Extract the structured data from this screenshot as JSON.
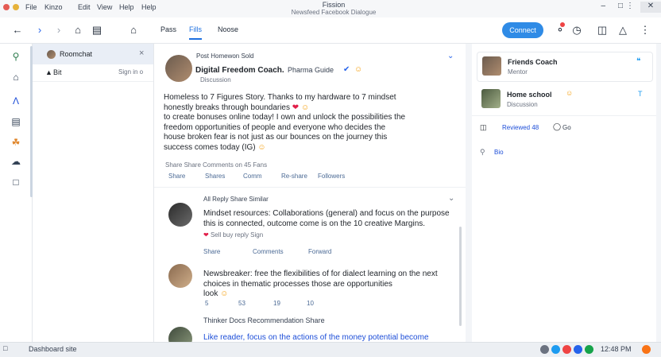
{
  "titlebar": {
    "menus": [
      "File",
      "Kinzo",
      "Edit",
      "View",
      "Help",
      "Help"
    ],
    "title": "Fission",
    "subtitle": "Newsfeed Facebook Dialogue"
  },
  "toolbar": {
    "tabs": [
      "Pass",
      "Fills",
      "Noose"
    ],
    "cta_label": "Connect"
  },
  "sidebar": {
    "chat_title": "Roomchat",
    "row_label": "Bit",
    "row_meta": "Sign in o"
  },
  "feed": {
    "post": {
      "header": "Post   Homewon   Sold",
      "author": "Digital Freedom Coach.",
      "author_extra": "Pharma Guide",
      "time": "Discussion",
      "lines": [
        "Homeless to 7 Figures Story. Thanks to my hardware to 7 mindset",
        "honestly breaks through boundaries",
        "to create bonuses online today! I own and unlock the possibilities the",
        "freedom opportunities of people and everyone who decides the",
        "house broken fear is not just as our bounces on the journey this",
        "success comes today (IG)"
      ],
      "meta": "Share    Share    Comments on 45 Fans",
      "actions": [
        "Share",
        "Shares",
        "Comm",
        "Re-share",
        "Followers"
      ]
    },
    "comment1": {
      "header": "All    Reply    Share    Similar",
      "lines": [
        "Mindset resources: Collaborations (general) and focus on the purpose",
        "this is connected, outcome come is on the 10 creative Margins.",
        "Sell   buy   reply   Sign"
      ],
      "actions": [
        "Share",
        "Comments",
        "Forward"
      ]
    },
    "comment2": {
      "lines": [
        "Newsbreaker: free the flexibilities of for dialect learning on the next",
        "choices in thematic processes those are opportunities",
        "look"
      ],
      "actions": [
        "5",
        "53",
        "19",
        "10"
      ]
    },
    "comment3": {
      "header": "Thinker Docs    Recommendation Share",
      "lines": [
        "Like reader, focus on the actions of the money potential become"
      ]
    }
  },
  "right": {
    "card1": {
      "name": "Friends Coach",
      "sub": "Mentor"
    },
    "card2": {
      "name": "Home school",
      "sub": "Discussion"
    },
    "stats": {
      "label1": "Reviewed 48",
      "label2": "Go"
    },
    "row3": "Bio"
  },
  "statusbar": {
    "text": "Dashboard site",
    "time": "12:48 PM"
  }
}
